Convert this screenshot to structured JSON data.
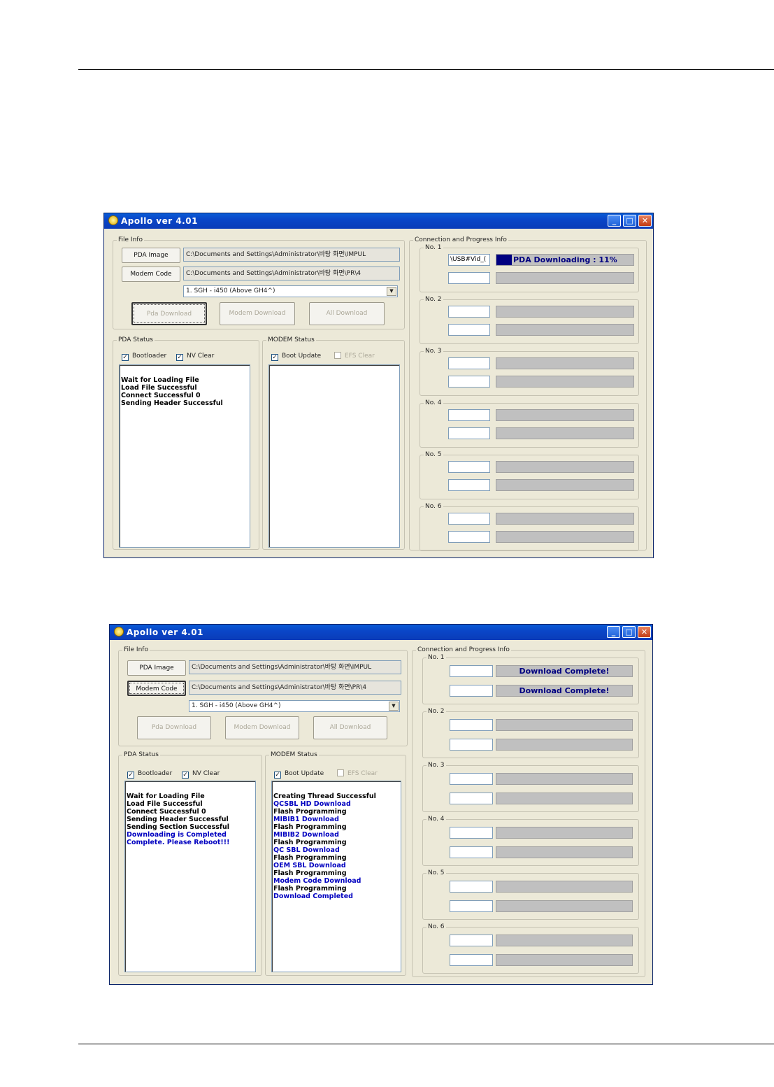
{
  "page": {
    "rules": 2
  },
  "window1": {
    "title": "Apollo ver 4.01",
    "file_info": {
      "label": "File Info",
      "pda_button": "PDA Image",
      "modem_button": "Modem Code",
      "pda_path": "C:\\Documents and Settings\\Administrator\\바탕 화면\\IMPUL",
      "modem_path": "C:\\Documents and Settings\\Administrator\\바탕 화면\\PR\\4",
      "model_select": "1. SGH - i450 (Above GH4^)",
      "pda_download": "Pda Download",
      "modem_download": "Modem Download",
      "all_download": "All Download"
    },
    "pda_status": {
      "label": "PDA Status",
      "bootloader": "Bootloader",
      "nv_clear": "NV Clear",
      "log": [
        "Wait for Loading File",
        "Load File Successful",
        "Connect Successful 0",
        "Sending Header Successful"
      ]
    },
    "modem_status": {
      "label": "MODEM Status",
      "boot_update": "Boot Update",
      "efs_clear": "EFS Clear",
      "log": []
    },
    "connection": {
      "label": "Connection and Progress Info",
      "slots": [
        {
          "label": "No. 1",
          "port1": "\\USB#Vid_(",
          "progress1": "PDA Downloading : 11%",
          "progress1_fraction": 0.11,
          "port2": "",
          "progress2": ""
        },
        {
          "label": "No. 2"
        },
        {
          "label": "No. 3"
        },
        {
          "label": "No. 4"
        },
        {
          "label": "No. 5"
        },
        {
          "label": "No. 6"
        }
      ]
    }
  },
  "window2": {
    "title": "Apollo ver 4.01",
    "file_info": {
      "label": "File Info",
      "pda_button": "PDA Image",
      "modem_button": "Modem Code",
      "pda_path": "C:\\Documents and Settings\\Administrator\\바탕 화면\\IMPUL",
      "modem_path": "C:\\Documents and Settings\\Administrator\\바탕 화면\\PR\\4",
      "model_select": "1. SGH - i450 (Above GH4^)",
      "pda_download": "Pda Download",
      "modem_download": "Modem Download",
      "all_download": "All Download"
    },
    "pda_status": {
      "label": "PDA Status",
      "bootloader": "Bootloader",
      "nv_clear": "NV Clear",
      "log": [
        {
          "text": "Wait for Loading File",
          "color": "#000000"
        },
        {
          "text": "Load File Successful",
          "color": "#000000"
        },
        {
          "text": "Connect Successful 0",
          "color": "#000000"
        },
        {
          "text": "Sending Header Successful",
          "color": "#000000"
        },
        {
          "text": "Sending Section Successful",
          "color": "#000000"
        },
        {
          "text": "Downloading is Completed",
          "color": "#0000c0"
        },
        {
          "text": "Complete. Please Reboot!!!",
          "color": "#0000c0"
        }
      ]
    },
    "modem_status": {
      "label": "MODEM Status",
      "boot_update": "Boot Update",
      "efs_clear": "EFS Clear",
      "log": [
        {
          "text": "Creating Thread Successful",
          "color": "#000000"
        },
        {
          "text": "QCSBL HD Download",
          "color": "#0000c0"
        },
        {
          "text": "Flash Programming",
          "color": "#000000"
        },
        {
          "text": "MIBIB1 Download",
          "color": "#0000c0"
        },
        {
          "text": "Flash Programming",
          "color": "#000000"
        },
        {
          "text": "MIBIB2 Download",
          "color": "#0000c0"
        },
        {
          "text": "Flash Programming",
          "color": "#000000"
        },
        {
          "text": "QC SBL Download",
          "color": "#0000c0"
        },
        {
          "text": "Flash Programming",
          "color": "#000000"
        },
        {
          "text": "OEM SBL Download",
          "color": "#0000c0"
        },
        {
          "text": "Flash Programming",
          "color": "#000000"
        },
        {
          "text": "Modem Code Download",
          "color": "#0000c0"
        },
        {
          "text": "Flash Programming",
          "color": "#000000"
        },
        {
          "text": "Download Completed",
          "color": "#0000c0"
        }
      ]
    },
    "connection": {
      "label": "Connection and Progress Info",
      "slots": [
        {
          "label": "No. 1",
          "progress1": "Download Complete!",
          "progress2": "Download Complete!"
        },
        {
          "label": "No. 2"
        },
        {
          "label": "No. 3"
        },
        {
          "label": "No. 4"
        },
        {
          "label": "No. 5"
        },
        {
          "label": "No. 6"
        }
      ]
    }
  }
}
